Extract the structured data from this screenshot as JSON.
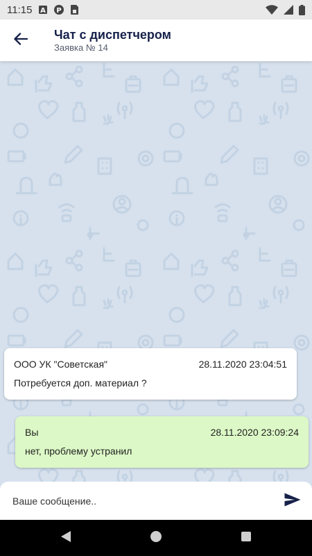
{
  "status_bar": {
    "time": "11:15",
    "icons_left": [
      "a-letter-icon",
      "p-circle-icon",
      "sim-icon"
    ],
    "icons_right": [
      "wifi-icon",
      "signal-icon",
      "battery-icon"
    ]
  },
  "header": {
    "title": "Чат с диспетчером",
    "subtitle": "Заявка № 14",
    "back_icon": "arrow-left-icon"
  },
  "messages": [
    {
      "sender": "ООО УК \"Советская\"",
      "timestamp": "28.11.2020 23:04:51",
      "text": "Потребуется доп. материал ?",
      "direction": "incoming"
    },
    {
      "sender": "Вы",
      "timestamp": "28.11.2020 23:09:24",
      "text": "нет, проблему устранил",
      "direction": "outgoing"
    }
  ],
  "composer": {
    "placeholder": "Ваше сообщение..",
    "value": "",
    "send_icon": "send-icon"
  },
  "nav_bar": {
    "buttons": [
      "back-triangle-icon",
      "home-circle-icon",
      "recents-square-icon"
    ]
  },
  "colors": {
    "accent": "#16214a",
    "chat_background": "#d6e1ed",
    "pattern": "#c3d2e3",
    "incoming_bubble": "#ffffff",
    "outgoing_bubble": "#dcf8c6"
  }
}
